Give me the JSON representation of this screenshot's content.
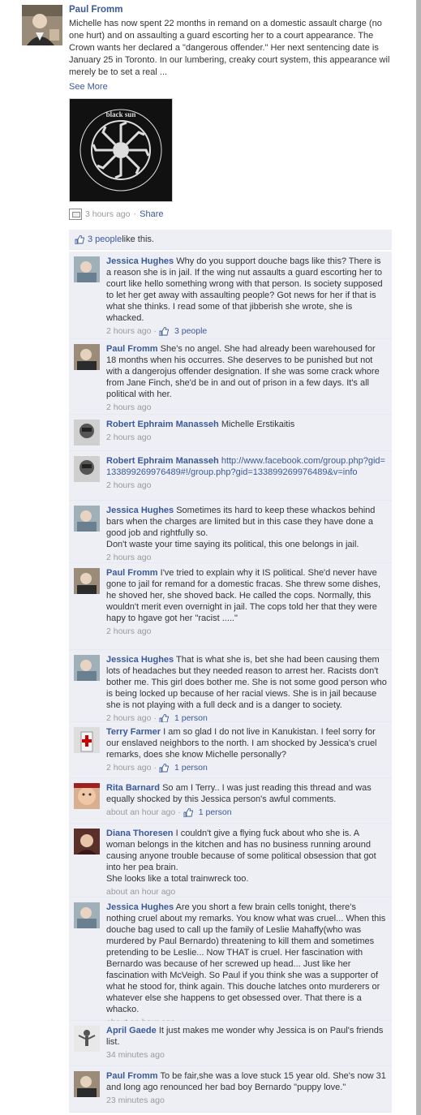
{
  "post": {
    "author": "Paul Fromm",
    "text": "Michelle has now spent 22 months in remand on a domestic assault charge (no one hurt) and on assaulting a guard escorting her to a court appearance. The Crown wants her declared a \"dangerous offender.\" Her next sentencing date is January 25 in Toronto. In our lumbering, creaky court system, this appearance wil merely be to set a real ...",
    "see_more": "See More",
    "image_text": "black sun",
    "time": "3 hours ago",
    "separator": "·",
    "share": "Share"
  },
  "likes": {
    "count_text": "3 people",
    "suffix": " like this."
  },
  "comments": [
    {
      "author": "Jessica Hughes",
      "text": "Why do you support douche bags like this? There is a reason she is in jail. If the wing nut assaults a guard escorting her to court like hello something wrong with that person. Is society supposed to let her get away with assaulting people? Got news for her if that is what she thinks. I read some of that jibberish she wrote, she is whacked.",
      "time": "2 hours ago",
      "likes": "3 people"
    },
    {
      "author": "Paul Fromm",
      "text": "She's no angel. She had already been warehoused for 18 months when his occurres. She deserves to be punished but not with a dangerojus offender designation. If she was some crack whore from Jane Finch, she'd be in and out of prison in a few days. It's all political with her.",
      "time": "2 hours ago",
      "likes": ""
    },
    {
      "author": "Robert Ephraim Manasseh",
      "text": "Michelle Erstikaitis",
      "time": "2 hours ago",
      "likes": ""
    },
    {
      "author": "Robert Ephraim Manasseh",
      "text": "",
      "link_text": "http://www.facebook.com/group.php?gid=133899269976489#!/group.php?gid=133899269976489&v=info",
      "time": "2 hours ago",
      "likes": ""
    },
    {
      "author": "Jessica Hughes",
      "text": "Sometimes its hard to keep these whackos behind bars when the charges are limited but in this case they have done a good job and rightfully so.\nDon't waste your time saying its political, this one belongs in jail.",
      "time": "2 hours ago",
      "likes": ""
    },
    {
      "author": "Paul Fromm",
      "text": "I've tried to explain why it IS political. She'd never have gone to jail for remand for a domestic fracas. She threw some dishes, he shoved her, she shoved back. He called the cops. Normally, this wouldn't merit even overnight in jail. The cops told her that they were hapy to hgave got her \"racist .....\"",
      "time": "2 hours ago",
      "likes": ""
    },
    {
      "author": "Jessica Hughes",
      "text": "That is what she is, bet she had been causing them lots of headaches but they needed reason to arrest her. Racists don't bother me. This girl does bother me. She is not some good person who is being locked up because of her racial views. She is in jail because she is not playing with a full deck and is a danger to society.",
      "time": "2 hours ago",
      "likes": "1 person"
    },
    {
      "author": "Terry Farmer",
      "text": "I am so glad I do not live in Kanukistan. I feel sorry for our enslaved neighbors to the north. I am shocked by Jessica's cruel remarks, does she know Michelle personally?",
      "time": "2 hours ago",
      "likes": "1 person"
    },
    {
      "author": "Rita Barnard",
      "text": "So am I Terry.. I was just reading this thread and was equally shocked by this Jessica person's awful comments.",
      "time": "about an hour ago",
      "likes": "1 person"
    },
    {
      "author": "Diana Thoresen",
      "text": "I couldn't give a flying fuck about who she is. A woman belongs in the kitchen and has no business running around causing anyone trouble because of some political obsession that got into her pea brain.\nShe looks like a total trainwreck too.",
      "time": "about an hour ago",
      "likes": ""
    },
    {
      "author": "Jessica Hughes",
      "text": "Are you short a few brain cells tonight, there's nothing cruel about my remarks. You know what was cruel... When this douche bag used to call up the family of Leslie Mahaffy(who was murdered by Paul Bernardo) threatening to kill them and sometimes pretending to be Leslie... Now THAT is cruel. Her fascination with Bernardo was because of her screwed up head... Just like her fascination with McVeigh. So Paul if you think she was a supporter of what he stood for, think again. This douche latches onto murderers or whatever else she happens to get obsessed over. That there is a whacko.",
      "time": "about an hour ago",
      "likes": ""
    },
    {
      "author": "April Gaede",
      "text": "It just makes me wonder why Jessica is on Paul's friends list.",
      "time": "34 minutes ago",
      "likes": ""
    },
    {
      "author": "Paul Fromm",
      "text": "To be fair,she was a love stuck 15 year old. She's now 31 and long ago renounced her bad boy Bernardo \"puppy love.\"",
      "time": "23 minutes ago",
      "likes": ""
    }
  ]
}
